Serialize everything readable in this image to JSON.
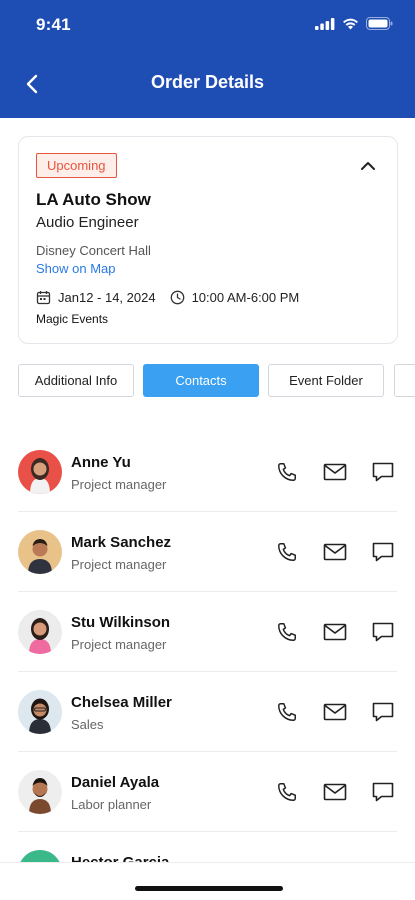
{
  "status_bar": {
    "time": "9:41"
  },
  "header": {
    "title": "Order Details"
  },
  "event": {
    "status_badge": "Upcoming",
    "title": "LA Auto Show",
    "role": "Audio Engineer",
    "venue": "Disney Concert Hall",
    "map_link": "Show on Map",
    "date": "Jan12 - 14, 2024",
    "time": "10:00 AM-6:00 PM",
    "organizer": "Magic Events"
  },
  "tabs": [
    {
      "label": "Additional Info",
      "active": false
    },
    {
      "label": "Contacts",
      "active": true
    },
    {
      "label": "Event Folder",
      "active": false
    },
    {
      "label": "",
      "active": false
    }
  ],
  "contacts": [
    {
      "name": "Anne Yu",
      "role": "Project manager"
    },
    {
      "name": "Mark Sanchez",
      "role": "Project manager"
    },
    {
      "name": "Stu Wilkinson",
      "role": "Project manager"
    },
    {
      "name": "Chelsea Miller",
      "role": "Sales"
    },
    {
      "name": "Daniel Ayala",
      "role": "Labor planner"
    },
    {
      "name": "Hector Garcia",
      "role": ""
    }
  ],
  "colors": {
    "header_bg": "#1e4db3",
    "active_tab": "#3aa0f2",
    "badge": "#e8553e",
    "link": "#2a7ae4"
  }
}
